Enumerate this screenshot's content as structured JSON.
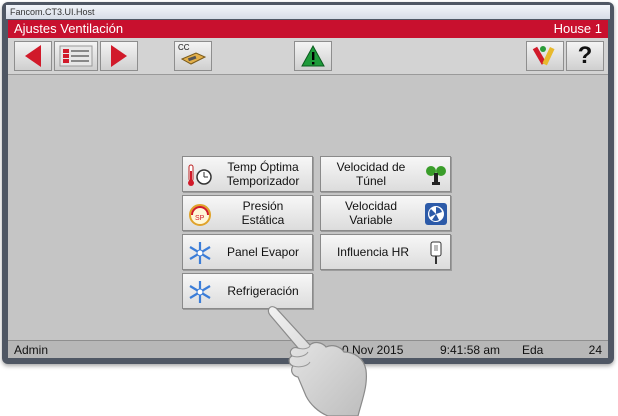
{
  "window_title": "Fancom.CT3.UI.Host",
  "header": {
    "title": "Ajustes Ventilación",
    "house": "House 1"
  },
  "toolbar": {
    "cc_label": "CC"
  },
  "buttons": [
    {
      "line1": "Temp Óptima",
      "line2": "Temporizador",
      "icon": "thermometer-clock-icon"
    },
    {
      "line1": "Velocidad de",
      "line2": "Túnel",
      "icon": "tunnel-fan-icon"
    },
    {
      "line1": "Presión",
      "line2": "Estática",
      "icon": "static-pressure-gauge-icon"
    },
    {
      "line1": "Velocidad",
      "line2": "Variable",
      "icon": "variable-speed-fan-icon"
    },
    {
      "line1": "Panel Evapor",
      "line2": "",
      "icon": "snowflake-icon"
    },
    {
      "line1": "Influencia HR",
      "line2": "",
      "icon": "humidity-sensor-icon"
    },
    {
      "line1": "Refrigeración",
      "line2": "",
      "icon": "snowflake-icon"
    }
  ],
  "status": {
    "user": "Admin",
    "date": "0 Nov 2015",
    "time": "9:41:58 am",
    "eda_label": "Eda",
    "eda_value": "24"
  },
  "colors": {
    "header_red": "#c8102e",
    "arrow_red": "#d11a2a",
    "screen_grey": "#c5c5c5"
  }
}
